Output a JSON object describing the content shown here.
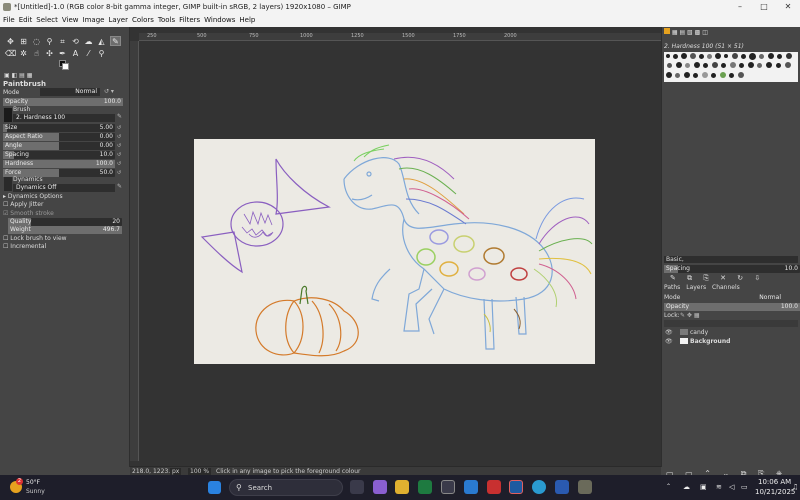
{
  "window": {
    "title": "*[Untitled]-1.0 (RGB color 8-bit gamma integer, GIMP built-in sRGB, 2 layers) 1920x1080 – GIMP",
    "min": "–",
    "max": "□",
    "close": "✕"
  },
  "menu": [
    "File",
    "Edit",
    "Select",
    "View",
    "Image",
    "Layer",
    "Colors",
    "Tools",
    "Filters",
    "Windows",
    "Help"
  ],
  "tool_options": {
    "header": "Paintbrush",
    "mode_label": "Mode",
    "mode_value": "Normal",
    "opacity_label": "Opacity",
    "opacity_value": "100.0",
    "brush_label": "Brush",
    "brush_value": "2. Hardness 100",
    "size_label": "Size",
    "size_value": "5.00",
    "aspect_label": "Aspect Ratio",
    "aspect_value": "0.00",
    "angle_label": "Angle",
    "angle_value": "0.00",
    "spacing_label": "Spacing",
    "spacing_value": "10.0",
    "hardness_label": "Hardness",
    "hardness_value": "100.0",
    "force_label": "Force",
    "force_value": "50.0",
    "dynamics_label": "Dynamics",
    "dynamics_value": "Dynamics Off",
    "dynamics_options": "Dynamics Options",
    "apply_jitter": "Apply Jitter",
    "smooth_stroke": "Smooth stroke",
    "quality_label": "Quality",
    "quality_value": "20",
    "weight_label": "Weight",
    "weight_value": "496.7",
    "lock_brush": "Lock brush to view",
    "incremental": "Incremental"
  },
  "ruler": {
    "ticks": [
      "250",
      "500",
      "750",
      "1000",
      "1250",
      "1500",
      "1750",
      "2000"
    ]
  },
  "status": {
    "coords": "218.0, 1223.0",
    "unit": "px",
    "zoom": "100 %",
    "message": "Click in any image to pick the foreground colour"
  },
  "brushes": {
    "title": "2. Hardness 100 (51 × 51)",
    "tag": "Basic,",
    "spacing_label": "Spacing",
    "spacing_value": "10.0"
  },
  "layers": {
    "tabs": [
      "Paths",
      "Layers",
      "Channels"
    ],
    "mode_label": "Mode",
    "mode_value": "Normal",
    "opacity_label": "Opacity",
    "opacity_value": "100.0",
    "lock_label": "Lock:",
    "items": [
      {
        "name": "candy",
        "bold": false
      },
      {
        "name": "Background",
        "bold": true
      }
    ]
  },
  "taskbar": {
    "weather_temp": "50°F",
    "weather_desc": "Sunny",
    "search": "Search",
    "time": "10:06 AM",
    "date": "10/21/2025",
    "badge": "2"
  },
  "colors": {
    "accent": "#e6a21f"
  }
}
